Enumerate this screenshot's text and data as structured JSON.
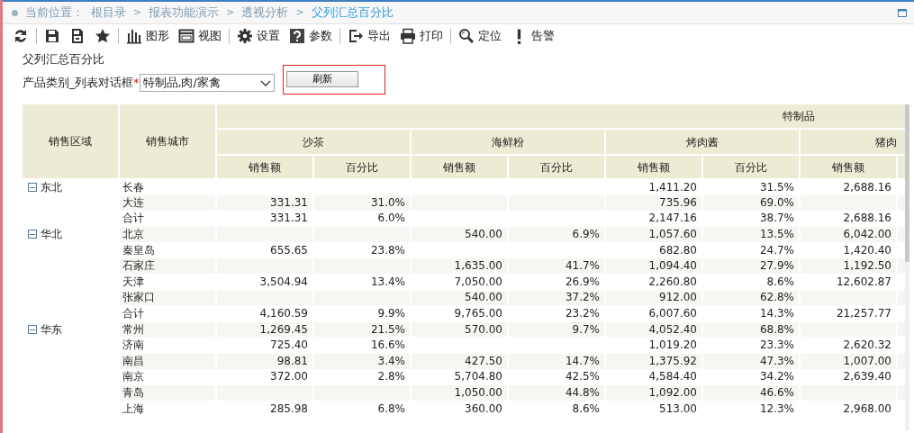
{
  "breadcrumb": {
    "label": "当前位置：",
    "items": [
      {
        "text": "根目录",
        "current": false
      },
      {
        "text": "报表功能演示",
        "current": false
      },
      {
        "text": "透视分析",
        "current": false
      },
      {
        "text": "父列汇总百分比",
        "current": true
      }
    ],
    "separator": ">"
  },
  "toolbar": [
    [
      {
        "kind": "refresh"
      }
    ],
    [
      {
        "kind": "save"
      },
      {
        "kind": "save-as"
      },
      {
        "kind": "star"
      }
    ],
    [
      {
        "kind": "chart",
        "label": "图形"
      },
      {
        "kind": "view",
        "label": "视图"
      }
    ],
    [
      {
        "kind": "settings",
        "label": "设置"
      },
      {
        "kind": "help",
        "label": "参数"
      }
    ],
    [
      {
        "kind": "export",
        "label": "导出"
      },
      {
        "kind": "print",
        "label": "打印"
      }
    ],
    [
      {
        "kind": "locate",
        "label": "定位"
      },
      {
        "kind": "alert",
        "label": "告警"
      }
    ]
  ],
  "params": {
    "title": "父列汇总百分比",
    "label": "产品类别_列表对话框",
    "required_mark": "*",
    "value": "特制品,肉/家禽",
    "button": "刷新",
    "button_highlighted": true
  },
  "table": {
    "row_headers": [
      "销售区域",
      "销售城市"
    ],
    "group_title": "特制品",
    "products": [
      {
        "name": "沙茶",
        "measures": [
          "销售额",
          "百分比"
        ]
      },
      {
        "name": "海鲜粉",
        "measures": [
          "销售额",
          "百分比"
        ]
      },
      {
        "name": "烤肉酱",
        "measures": [
          "销售额",
          "百分比"
        ]
      },
      {
        "name": "猪肉",
        "measures": [
          "销售额"
        ]
      }
    ],
    "groups": [
      {
        "region": "东北",
        "expanded": true,
        "rows": [
          {
            "city": "长春",
            "cells": [
              null,
              null,
              null,
              null,
              "1,411.20",
              "31.5%",
              "2,688.16"
            ]
          },
          {
            "city": "大连",
            "cells": [
              "331.31",
              "31.0%",
              null,
              null,
              "735.96",
              "69.0%",
              null
            ]
          },
          {
            "city": "合计",
            "cells": [
              "331.31",
              "6.0%",
              null,
              null,
              "2,147.16",
              "38.7%",
              "2,688.16"
            ]
          }
        ]
      },
      {
        "region": "华北",
        "expanded": true,
        "rows": [
          {
            "city": "北京",
            "cells": [
              null,
              null,
              "540.00",
              "6.9%",
              "1,057.60",
              "13.5%",
              "6,042.00"
            ]
          },
          {
            "city": "秦皇岛",
            "cells": [
              "655.65",
              "23.8%",
              null,
              null,
              "682.80",
              "24.7%",
              "1,420.40"
            ]
          },
          {
            "city": "石家庄",
            "cells": [
              null,
              null,
              "1,635.00",
              "41.7%",
              "1,094.40",
              "27.9%",
              "1,192.50"
            ]
          },
          {
            "city": "天津",
            "cells": [
              "3,504.94",
              "13.4%",
              "7,050.00",
              "26.9%",
              "2,260.80",
              "8.6%",
              "12,602.87"
            ]
          },
          {
            "city": "张家口",
            "cells": [
              null,
              null,
              "540.00",
              "37.2%",
              "912.00",
              "62.8%",
              null
            ]
          },
          {
            "city": "合计",
            "cells": [
              "4,160.59",
              "9.9%",
              "9,765.00",
              "23.2%",
              "6,007.60",
              "14.3%",
              "21,257.77"
            ]
          }
        ]
      },
      {
        "region": "华东",
        "expanded": true,
        "rows": [
          {
            "city": "常州",
            "cells": [
              "1,269.45",
              "21.5%",
              "570.00",
              "9.7%",
              "4,052.40",
              "68.8%",
              null
            ]
          },
          {
            "city": "济南",
            "cells": [
              "725.40",
              "16.6%",
              null,
              null,
              "1,019.20",
              "23.3%",
              "2,620.32"
            ]
          },
          {
            "city": "南昌",
            "cells": [
              "98.81",
              "3.4%",
              "427.50",
              "14.7%",
              "1,375.92",
              "47.3%",
              "1,007.00"
            ]
          },
          {
            "city": "南京",
            "cells": [
              "372.00",
              "2.8%",
              "5,704.80",
              "42.5%",
              "4,584.40",
              "34.2%",
              "2,639.40"
            ]
          },
          {
            "city": "青岛",
            "cells": [
              null,
              null,
              "1,050.00",
              "44.8%",
              "1,092.00",
              "46.6%",
              null
            ]
          },
          {
            "city": "上海",
            "cells": [
              "285.98",
              "6.8%",
              "360.00",
              "8.6%",
              "513.00",
              "12.3%",
              "2,968.00"
            ]
          }
        ]
      }
    ]
  }
}
